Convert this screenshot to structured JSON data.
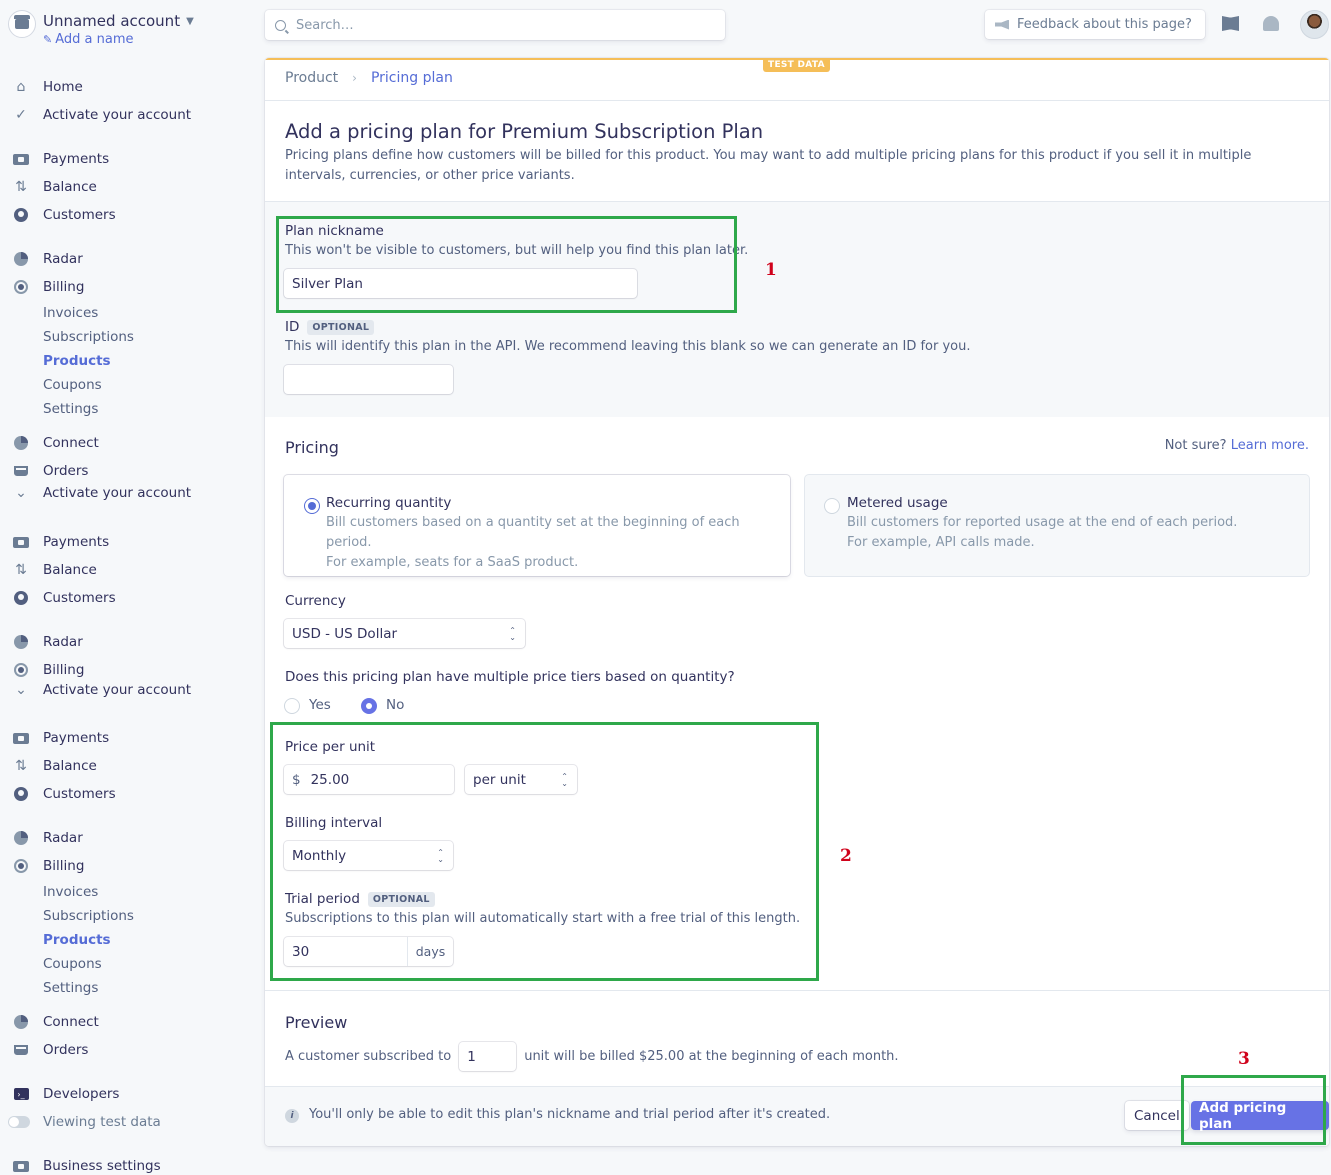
{
  "account": {
    "name": "Unnamed account",
    "add_name": "Add a name"
  },
  "sidebar": {
    "home": "Home",
    "activate": "Activate your account",
    "payments": "Payments",
    "balance": "Balance",
    "customers": "Customers",
    "radar": "Radar",
    "billing": "Billing",
    "invoices": "Invoices",
    "subscriptions": "Subscriptions",
    "products": "Products",
    "coupons": "Coupons",
    "settings": "Settings",
    "connect": "Connect",
    "orders": "Orders",
    "developers": "Developers",
    "viewing_test": "Viewing test data",
    "business_settings": "Business settings"
  },
  "topbar": {
    "search_placeholder": "Search…",
    "feedback": "Feedback about this page?"
  },
  "test_badge": "TEST DATA",
  "breadcrumb": {
    "parent": "Product",
    "current": "Pricing plan"
  },
  "page": {
    "title": "Add a pricing plan for Premium Subscription Plan",
    "description": "Pricing plans define how customers will be billed for this product. You may want to add multiple pricing plans for this product if you sell it in multiple intervals, currencies, or other price variants."
  },
  "form": {
    "nickname_label": "Plan nickname",
    "nickname_help": "This won't be visible to customers, but will help you find this plan later.",
    "nickname_value": "Silver Plan",
    "id_label": "ID",
    "optional": "OPTIONAL",
    "id_help": "This will identify this plan in the API. We recommend leaving this blank so we can generate an ID for you.",
    "id_value": "",
    "pricing_heading": "Pricing",
    "not_sure": "Not sure?",
    "learn_more": "Learn more.",
    "recurring_title": "Recurring quantity",
    "recurring_desc1": "Bill customers based on a quantity set at the beginning of each period.",
    "recurring_desc2": "For example, seats for a SaaS product.",
    "metered_title": "Metered usage",
    "metered_desc1": "Bill customers for reported usage at the end of each period.",
    "metered_desc2": "For example, API calls made.",
    "currency_label": "Currency",
    "currency_value": "USD - US Dollar",
    "tiers_question": "Does this pricing plan have multiple price tiers based on quantity?",
    "yes": "Yes",
    "no": "No",
    "price_label": "Price per unit",
    "price_symbol": "$",
    "price_value": "25.00",
    "unit_value": "per unit",
    "interval_label": "Billing interval",
    "interval_value": "Monthly",
    "trial_label": "Trial period",
    "trial_help": "Subscriptions to this plan will automatically start with a free trial of this length.",
    "trial_value": "30",
    "trial_suffix": "days"
  },
  "preview": {
    "heading": "Preview",
    "before": "A customer subscribed to",
    "qty": "1",
    "after": "unit will be billed $25.00 at the beginning of each month."
  },
  "footer": {
    "note": "You'll only be able to edit this plan's nickname and trial period after it's created.",
    "cancel": "Cancel",
    "add": "Add pricing plan"
  },
  "annotations": {
    "one": "1",
    "two": "2",
    "three": "3",
    "color": "#2ea84a",
    "num_color": "#d0021b"
  },
  "colors": {
    "accent": "#556cd6",
    "button": "#6772e5",
    "test": "#f5be58"
  }
}
